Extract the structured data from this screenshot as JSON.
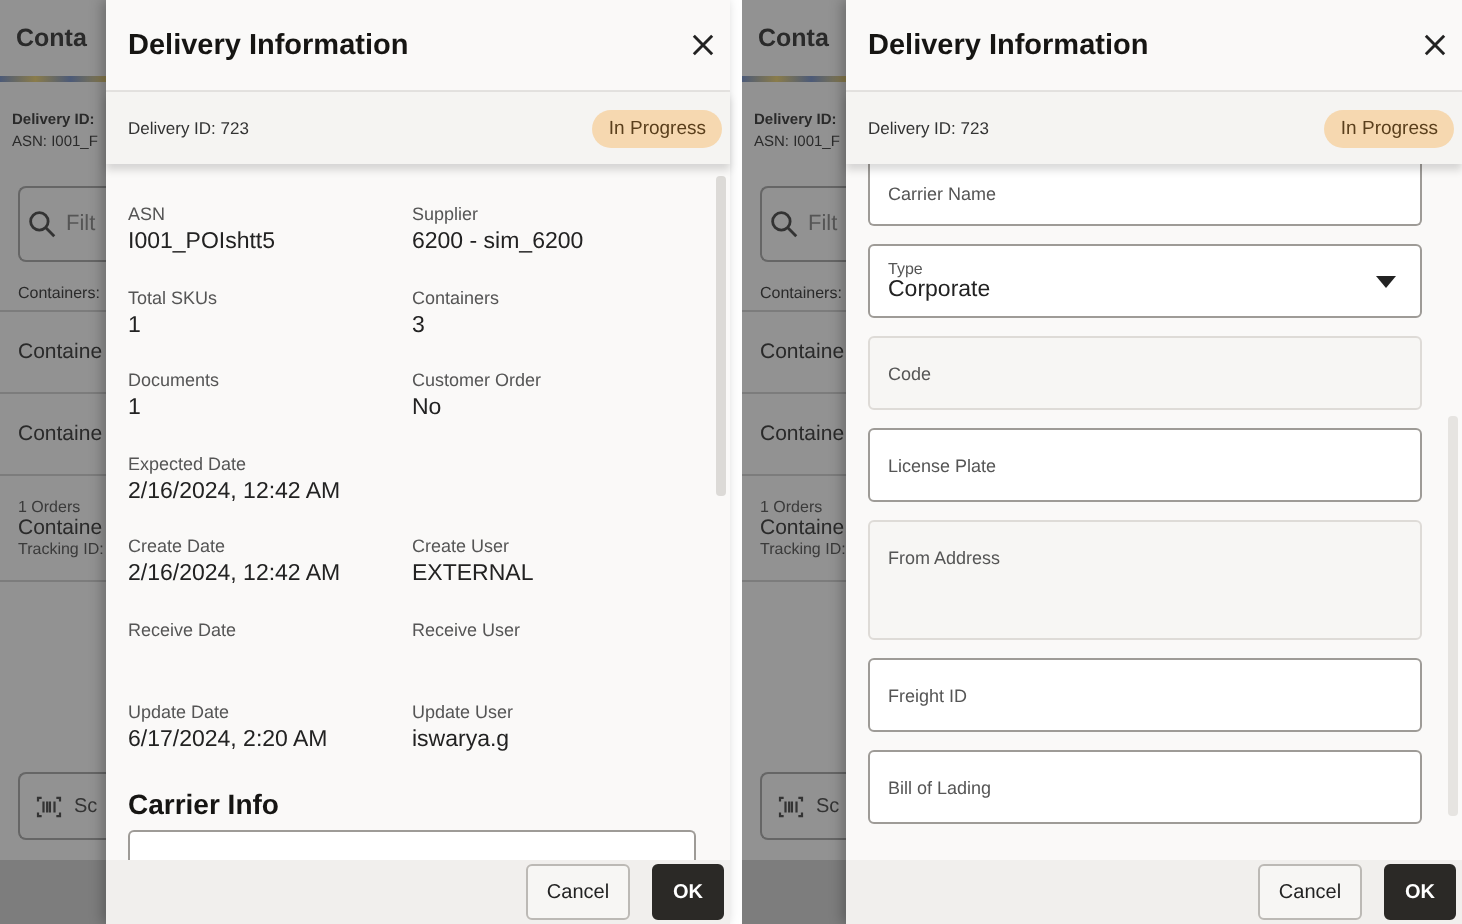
{
  "screens": [
    {
      "background": {
        "title": "Conta",
        "delivery_id": "Delivery ID:",
        "asn": "ASN: I001_F",
        "search_placeholder": "Filt",
        "containers_label": "Containers:",
        "list": [
          {
            "name": "Containe"
          },
          {
            "name": "Containe"
          },
          {
            "orders": "1 Orders",
            "name": "Containe",
            "tracking": "Tracking ID:"
          }
        ],
        "scan_label": "Sc"
      },
      "drawer": {
        "title": "Delivery Information",
        "delivery_id": "Delivery ID: 723",
        "status": "In Progress",
        "details": [
          [
            {
              "label": "ASN",
              "value": "I001_POIshtt5"
            },
            {
              "label": "Supplier",
              "value": "6200 - sim_6200"
            }
          ],
          [
            {
              "label": "Total SKUs",
              "value": "1"
            },
            {
              "label": "Containers",
              "value": "3"
            }
          ],
          [
            {
              "label": "Documents",
              "value": "1"
            },
            {
              "label": "Customer Order",
              "value": "No"
            }
          ],
          [
            {
              "label": "Expected Date",
              "value": "2/16/2024, 12:42 AM"
            }
          ],
          [
            {
              "label": "Create Date",
              "value": "2/16/2024, 12:42 AM"
            },
            {
              "label": "Create User",
              "value": "EXTERNAL"
            }
          ],
          [
            {
              "label": "Receive Date"
            },
            {
              "label": "Receive User"
            }
          ],
          [
            {
              "label": "Update Date",
              "value": "6/17/2024, 2:20 AM"
            },
            {
              "label": "Update User",
              "value": "iswarya.g"
            }
          ]
        ],
        "section_title": "Carrier Info",
        "fields": [
          {
            "kind": "cut-bottom",
            "disabled": false
          }
        ],
        "buttons": [
          "Cancel",
          "OK"
        ]
      }
    },
    {
      "background": {
        "title": "Conta",
        "delivery_id": "Delivery ID:",
        "asn": "ASN: I001_F",
        "search_placeholder": "Filt",
        "containers_label": "Containers:",
        "list": [
          {
            "name": "Containe"
          },
          {
            "name": "Containe"
          },
          {
            "orders": "1 Orders",
            "name": "Containe",
            "tracking": "Tracking ID:"
          }
        ],
        "scan_label": "Sc"
      },
      "drawer": {
        "title": "Delivery Information",
        "delivery_id": "Delivery ID: 723",
        "status": "In Progress",
        "fields": [
          {
            "kind": "cut-top",
            "label": "Carrier Name",
            "disabled": false
          },
          {
            "kind": "select",
            "label": "Type",
            "value": "Corporate",
            "disabled": false
          },
          {
            "kind": "text",
            "label": "Code",
            "disabled": true
          },
          {
            "kind": "text",
            "label": "License Plate",
            "disabled": false
          },
          {
            "kind": "textarea",
            "label": "From Address",
            "disabled": true
          },
          {
            "kind": "text",
            "label": "Freight ID",
            "disabled": false
          },
          {
            "kind": "text",
            "label": "Bill of Lading",
            "disabled": false
          }
        ],
        "buttons": [
          "Cancel",
          "OK"
        ]
      }
    }
  ]
}
